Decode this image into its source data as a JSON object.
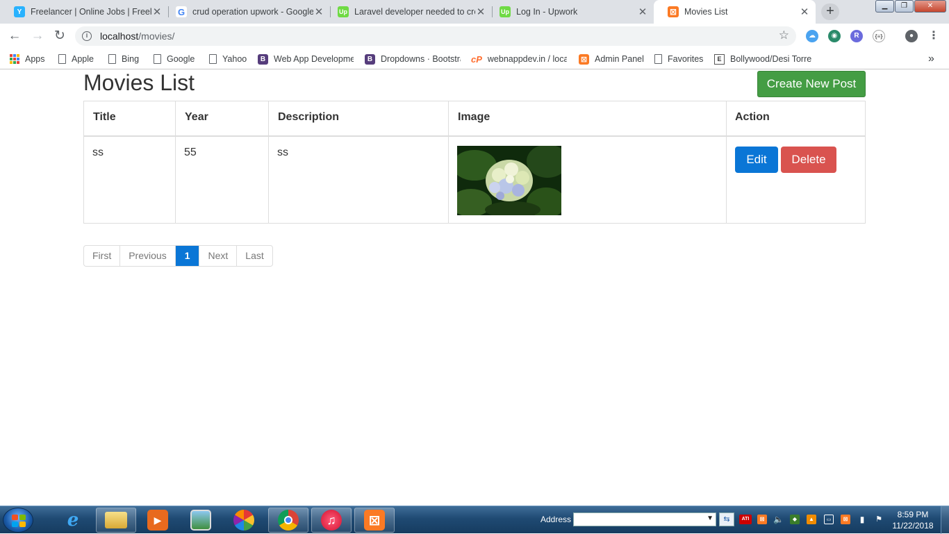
{
  "tabs": [
    {
      "title": "Freelancer | Online Jobs | Freelan",
      "favicon": "freelancer-icon",
      "color": "#29b2fe",
      "glyph": "Y"
    },
    {
      "title": "crud operation upwork - Google",
      "favicon": "google-icon",
      "color": "#4285f4",
      "glyph": "G"
    },
    {
      "title": "Laravel developer needed to cre",
      "favicon": "upwork-icon",
      "color": "#6fda44",
      "glyph": "Up"
    },
    {
      "title": "Log In - Upwork",
      "favicon": "upwork-icon",
      "color": "#6fda44",
      "glyph": "Up"
    },
    {
      "title": "Movies List",
      "favicon": "xampp-icon",
      "color": "#fb7a24",
      "glyph": "⊠",
      "active": true
    }
  ],
  "address_bar": {
    "host": "localhost",
    "path": "/movies/"
  },
  "bookmarks": [
    {
      "label": "Apps",
      "icon": "apps-grid-icon"
    },
    {
      "label": "Apple",
      "icon": "page-icon"
    },
    {
      "label": "Bing",
      "icon": "page-icon"
    },
    {
      "label": "Google",
      "icon": "page-icon"
    },
    {
      "label": "Yahoo",
      "icon": "page-icon"
    },
    {
      "label": "Web App Developme",
      "icon": "bootstrap-icon"
    },
    {
      "label": "Dropdowns · Bootstra",
      "icon": "bootstrap-icon"
    },
    {
      "label": "webnappdev.in / loca",
      "icon": "cpanel-icon"
    },
    {
      "label": "Admin Panel",
      "icon": "xampp-icon"
    },
    {
      "label": "Favorites",
      "icon": "page-icon"
    },
    {
      "label": "Bollywood/Desi Torre",
      "icon": "torrent-icon"
    }
  ],
  "bookmarks_overflow": "»",
  "page": {
    "title": "Movies List",
    "create_button": "Create New Post",
    "table": {
      "headers": [
        "Title",
        "Year",
        "Description",
        "Image",
        "Action"
      ],
      "rows": [
        {
          "title": "ss",
          "year": "55",
          "description": "ss",
          "image": "hydrangea-flower-photo"
        }
      ]
    },
    "actions": {
      "edit": "Edit",
      "delete": "Delete"
    },
    "pagination": {
      "first": "First",
      "previous": "Previous",
      "current": "1",
      "next": "Next",
      "last": "Last"
    }
  },
  "taskbar": {
    "address_label": "Address",
    "clock_time": "8:59 PM",
    "clock_date": "11/22/2018",
    "tray_badge": "ATI"
  },
  "colors": {
    "success": "#449d44",
    "primary": "#0a76d6",
    "danger": "#d9534f"
  }
}
